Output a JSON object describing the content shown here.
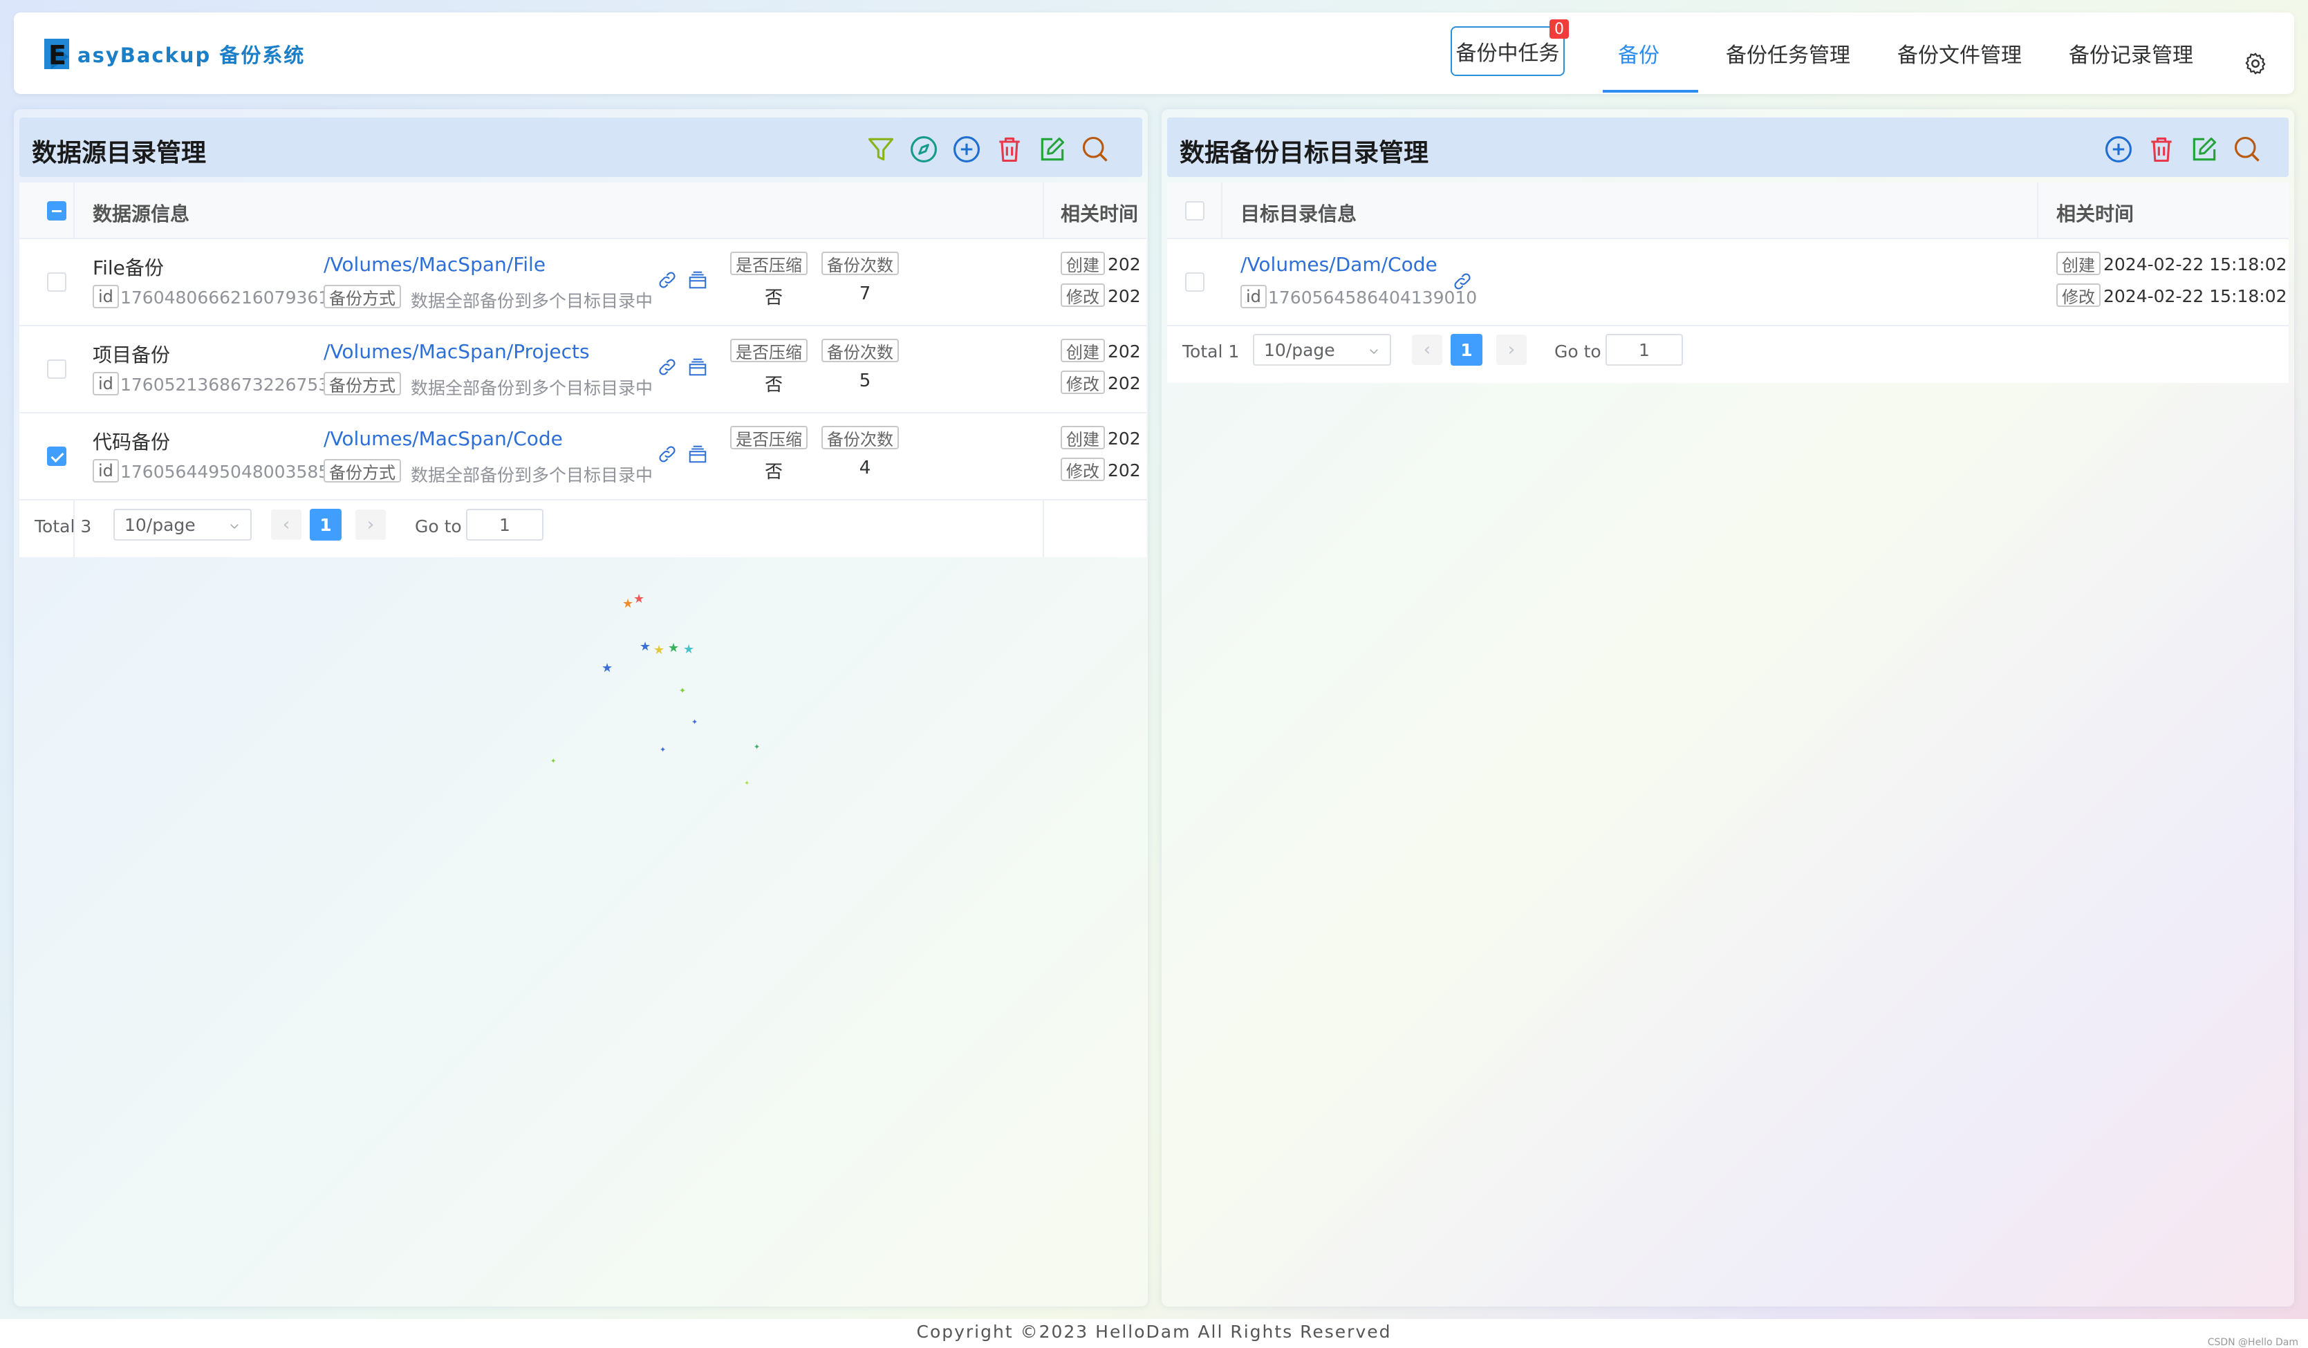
{
  "app": {
    "logo_text": "asyBackup 备份系统",
    "logo_letter": "E"
  },
  "header": {
    "task_button": "备份中任务",
    "task_badge": "0",
    "menu": [
      "备份",
      "备份任务管理",
      "备份文件管理",
      "备份记录管理"
    ],
    "active_menu": "备份"
  },
  "left_panel": {
    "title": "数据源目录管理",
    "columns": [
      "数据源信息",
      "相关时间"
    ],
    "labels": {
      "id": "id",
      "method": "备份方式",
      "compress": "是否压缩",
      "count": "备份次数",
      "created": "创建",
      "modified": "修改"
    },
    "rows": [
      {
        "name": "File备份",
        "id": "1760480666216079361",
        "path": "/Volumes/MacSpan/File",
        "method_desc": "数据全部备份到多个目标目录中",
        "compress": "否",
        "count": "7",
        "created": "202",
        "modified": "202",
        "checked": false
      },
      {
        "name": "项目备份",
        "id": "1760521368673226753",
        "path": "/Volumes/MacSpan/Projects",
        "method_desc": "数据全部备份到多个目标目录中",
        "compress": "否",
        "count": "5",
        "created": "202",
        "modified": "202",
        "checked": false
      },
      {
        "name": "代码备份",
        "id": "1760564495048003585",
        "path": "/Volumes/MacSpan/Code",
        "method_desc": "数据全部备份到多个目标目录中",
        "compress": "否",
        "count": "4",
        "created": "202",
        "modified": "202",
        "checked": true
      }
    ],
    "pager": {
      "total": "Total 3",
      "page_size": "10/page",
      "current": "1",
      "goto_label": "Go to",
      "goto_value": "1",
      "prev": "‹",
      "next": "›"
    }
  },
  "right_panel": {
    "title": "数据备份目标目录管理",
    "columns": [
      "目标目录信息",
      "相关时间"
    ],
    "labels": {
      "id": "id",
      "created": "创建",
      "modified": "修改"
    },
    "rows": [
      {
        "path": "/Volumes/Dam/Code",
        "id": "1760564586404139010",
        "created": "2024-02-22 15:18:02",
        "modified": "2024-02-22 15:18:02",
        "checked": false
      }
    ],
    "pager": {
      "total": "Total 1",
      "page_size": "10/page",
      "current": "1",
      "goto_label": "Go to",
      "goto_value": "1",
      "prev": "‹",
      "next": "›"
    }
  },
  "footer": {
    "copyright": "Copyright  ©2023  HelloDam  All Rights Reserved",
    "watermark": "CSDN @Hello Dam"
  },
  "colors": {
    "accent": "#2d8cf0",
    "link": "#2d6fd6",
    "badge": "#f23b3b",
    "filter_icon": "#8ab31a",
    "compass_icon": "#17998c",
    "add_icon": "#1f6fd0",
    "delete_icon": "#e8394a",
    "edit_icon": "#23a33a",
    "search_icon": "#b8590f"
  }
}
